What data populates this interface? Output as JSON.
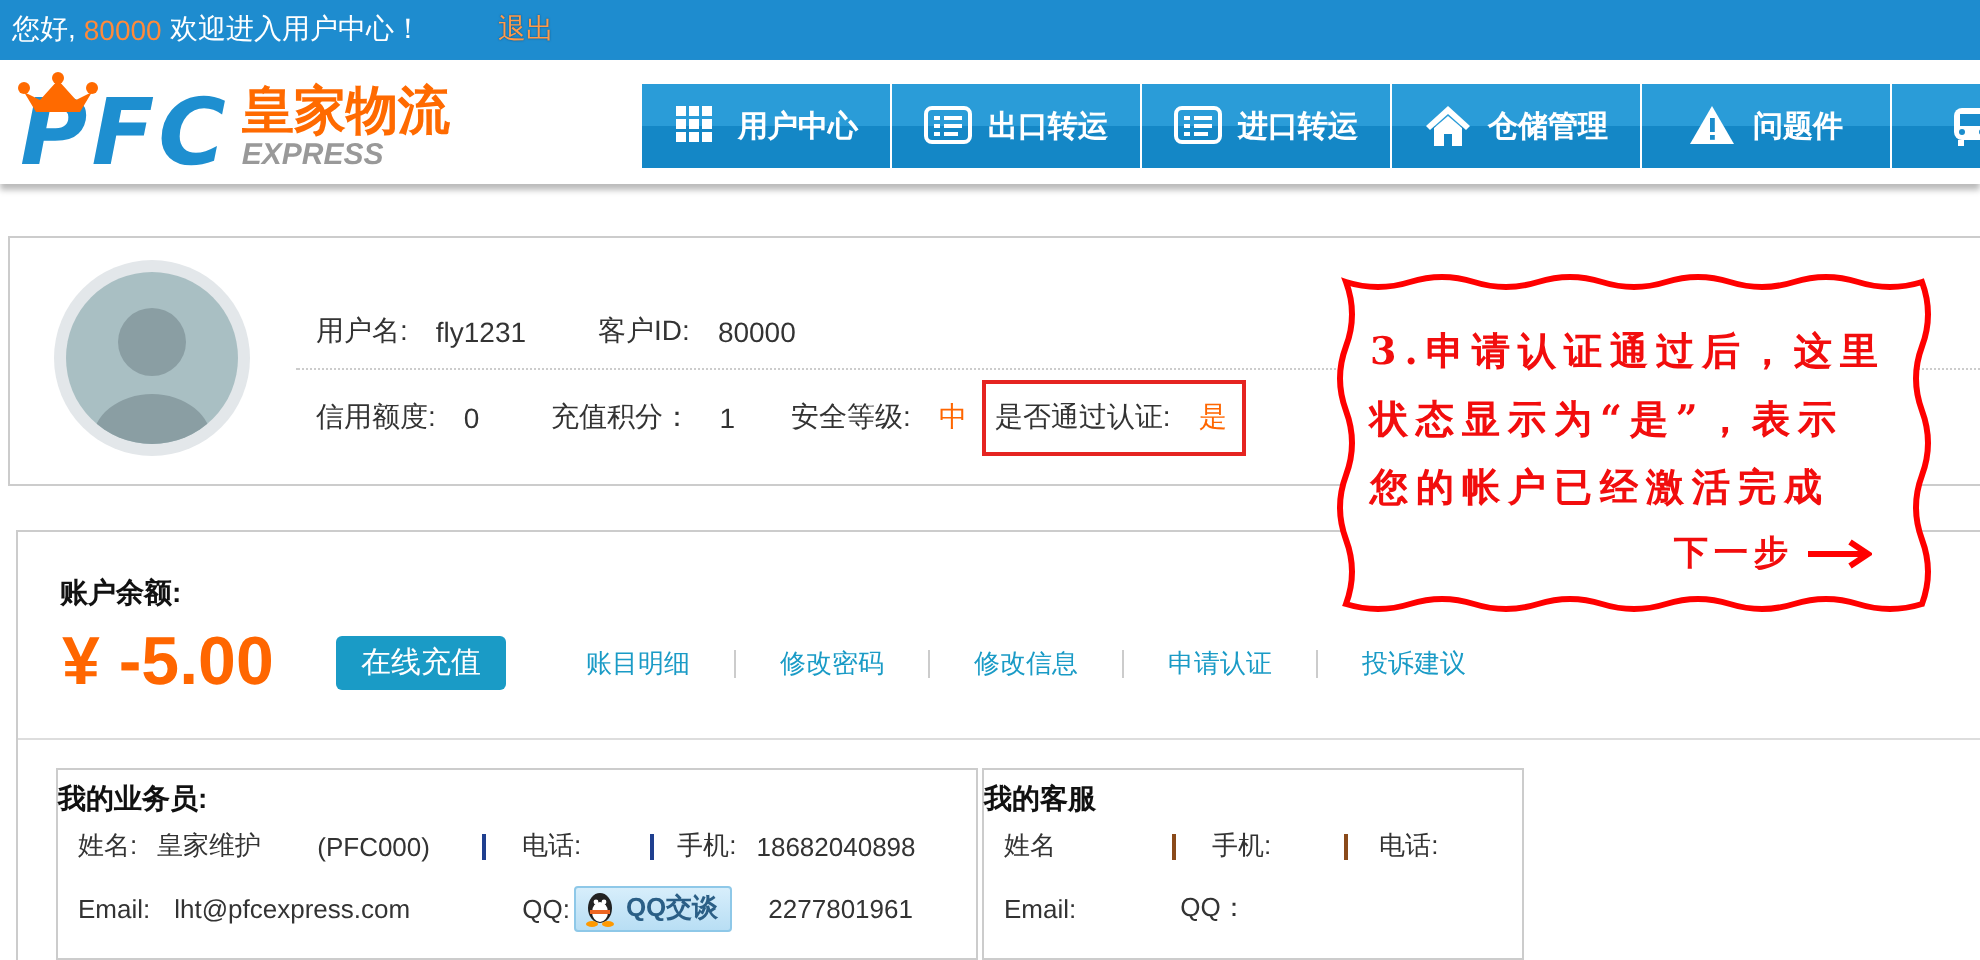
{
  "top_bar": {
    "greeting": "您好,",
    "user_id": "80000",
    "welcome": "欢迎进入用户中心！",
    "logout": "退出"
  },
  "logo": {
    "letters": "PFC",
    "name": "皇家物流",
    "subtitle": "EXPRESS"
  },
  "nav": [
    {
      "label": "用户中心"
    },
    {
      "label": "出口转运"
    },
    {
      "label": "进口转运"
    },
    {
      "label": "仓储管理"
    },
    {
      "label": "问题件"
    }
  ],
  "profile": {
    "row_1": [
      {
        "label": "用户名:",
        "value": "fly1231",
        "highlight": false,
        "outlined": false
      },
      {
        "label": "客户ID:",
        "value": "80000",
        "highlight": false,
        "outlined": false
      }
    ],
    "row_2": [
      {
        "label": "信用额度:",
        "value": "0",
        "highlight": false,
        "outlined": false
      },
      {
        "label": "充值积分：",
        "value": "1",
        "highlight": false,
        "outlined": false
      },
      {
        "label": "安全等级:",
        "value": "中",
        "highlight": true,
        "outlined": false
      },
      {
        "label": "是否通过认证:",
        "value": "是",
        "highlight": true,
        "outlined": true
      }
    ]
  },
  "callout": {
    "lines": [
      "3.申请认证通过后，这里",
      "状态显示为“是”，表示",
      "您的帐户已经激活完成"
    ],
    "next": "下一步"
  },
  "balance": {
    "label": "账户余额:",
    "amount": "¥ -5.00",
    "recharge": "在线充值",
    "links": [
      "账目明细",
      "修改密码",
      "修改信息",
      "申请认证",
      "投诉建议"
    ]
  },
  "salesperson": {
    "title": "我的业务员:",
    "name_label": "姓名:",
    "name": "皇家维护",
    "code": "(PFC000)",
    "phone_label": "电话:",
    "mobile_label": "手机:",
    "mobile": "18682040898",
    "email_label": "Email:",
    "email": "lht@pfcexpress.com",
    "qq_label": "QQ:",
    "qq_button": "QQ交谈",
    "qq": "2277801961"
  },
  "customer_service": {
    "title": "我的客服",
    "name_label": "姓名",
    "mobile_label": "手机:",
    "phone_label": "电话:",
    "email_label": "Email:",
    "qq_label": "QQ："
  }
}
